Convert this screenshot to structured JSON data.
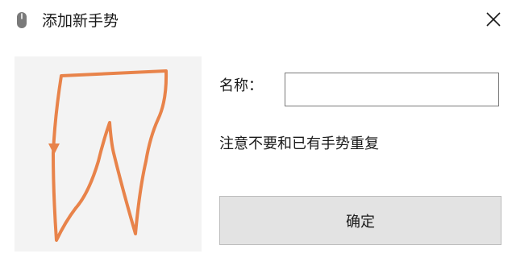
{
  "window": {
    "title": "添加新手势",
    "app_icon": "mouse-icon",
    "close_icon": "close-icon"
  },
  "gesture_canvas": {
    "stroke_color": "#e8834a",
    "background": "#f3f3f3"
  },
  "form": {
    "name_label": "名称：",
    "name_value": "",
    "hint": "注意不要和已有手势重复",
    "confirm_label": "确定"
  }
}
